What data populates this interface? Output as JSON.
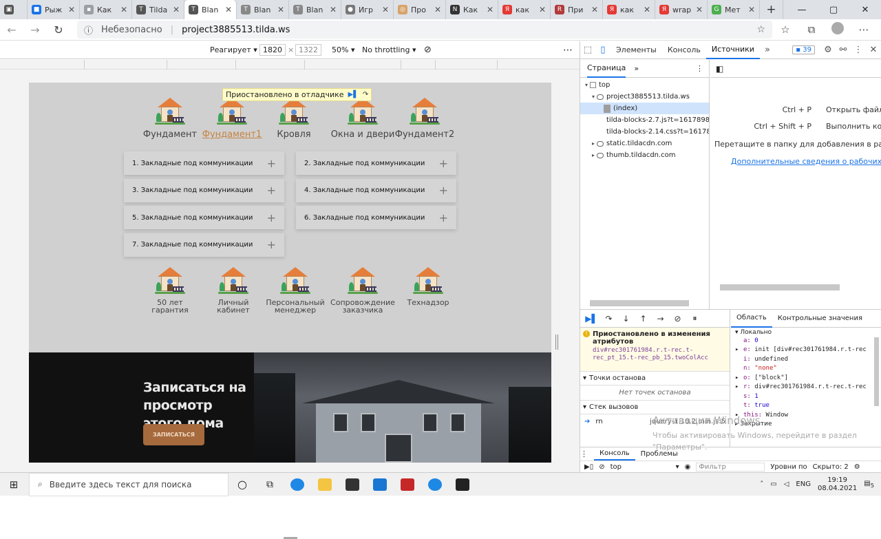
{
  "browser": {
    "tabs": [
      {
        "label": "Рыж",
        "color": "#1a73e8",
        "glyph": "■"
      },
      {
        "label": "Как",
        "color": "#9aa0a6",
        "glyph": "▪"
      },
      {
        "label": "Tilda",
        "color": "#555555",
        "glyph": "T"
      },
      {
        "label": "Blan",
        "color": "#555555",
        "glyph": "T"
      },
      {
        "label": "Blan",
        "color": "#888888",
        "glyph": "T"
      },
      {
        "label": "Blan",
        "color": "#888888",
        "glyph": "T"
      },
      {
        "label": "Игр",
        "color": "#777777",
        "glyph": "●"
      },
      {
        "label": "Про",
        "color": "#d7a36a",
        "glyph": "◎"
      },
      {
        "label": "Как",
        "color": "#333333",
        "glyph": "N"
      },
      {
        "label": "как",
        "color": "#e53935",
        "glyph": "Я"
      },
      {
        "label": "При",
        "color": "#b23b3b",
        "glyph": "R"
      },
      {
        "label": "как",
        "color": "#e53935",
        "glyph": "Я"
      },
      {
        "label": "wrap",
        "color": "#e53935",
        "glyph": "Я"
      },
      {
        "label": "Мет",
        "color": "#4caf50",
        "glyph": "G"
      }
    ],
    "active_tab": 3,
    "new_tab": "+",
    "url_security": "Небезопасно",
    "url": "project3885513.tilda.ws"
  },
  "devbar": {
    "responsive": "Реагирует",
    "width": "1820",
    "height": "1322",
    "zoom": "50%",
    "throttle": "No throttling"
  },
  "site": {
    "paused_label": "Приостановлено в отладчике",
    "categories": [
      {
        "label": "Фундамент",
        "active": false
      },
      {
        "label": "Фундамент1",
        "active": true
      },
      {
        "label": "Кровля",
        "active": false
      },
      {
        "label": "Окна и двери",
        "active": false
      },
      {
        "label": "Фундамент2",
        "active": false
      }
    ],
    "accordion": [
      "1. Закладные под коммуникации",
      "2. Закладные под коммуникации",
      "3. Закладные под коммуникации",
      "4. Закладные под коммуникации",
      "5. Закладные под коммуникации",
      "6. Закладные под коммуникации",
      "7. Закладные под коммуникации"
    ],
    "features": [
      {
        "l1": "50 лет",
        "l2": "гарантия"
      },
      {
        "l1": "Личный",
        "l2": "кабинет"
      },
      {
        "l1": "Персональный",
        "l2": "менеджер"
      },
      {
        "l1": "Сопровождение",
        "l2": "заказчика"
      },
      {
        "l1": "Технадзор",
        "l2": ""
      }
    ],
    "banner_title_1": "Записаться на просмотр",
    "banner_title_2": "этого дома",
    "banner_button": "ЗАПИСАТЬСЯ"
  },
  "devtools": {
    "tabs": [
      "Элементы",
      "Консоль",
      "Источники"
    ],
    "active_tab": "Источники",
    "issues_count": "39",
    "nav_tab": "Страница",
    "tree": {
      "top": "top",
      "project": "project3885513.tilda.ws",
      "index": "(index)",
      "js": "tilda-blocks-2.7.js?t=16178980",
      "css": "tilda-blocks-2.14.css?t=161789",
      "static": "static.tildacdn.com",
      "thumb": "thumb.tildacdn.com"
    },
    "shortcuts": [
      {
        "keys": "Ctrl + P",
        "action": "Открыть файл"
      },
      {
        "keys": "Ctrl + Shift + P",
        "action": "Выполнить ком"
      }
    ],
    "drop_hint": "Перетащите в папку для добавления в рабоч",
    "more_info": "Дополнительные сведения о рабочих об",
    "paused_title": "Приостановлено в изменения атрибутов",
    "paused_code": "div#rec301761984.r.t-rec.t-rec_pt_15.t-rec_pb_15.twoColAcc",
    "breakpoints_title": "Точки останова",
    "no_breakpoints": "Нет точек останова",
    "callstack_title": "Стек вызовов",
    "stack_fn": "rn",
    "stack_file": "jquery-1.10.2.min.js:5",
    "scope_tab": "Область",
    "watch_tab": "Контрольные значения",
    "local": "Локально",
    "scope": [
      {
        "k": "a:",
        "v": "0",
        "cls": "n",
        "exp": ""
      },
      {
        "k": "e:",
        "v": "init [div#rec301761984.r.t-rec",
        "cls": "",
        "exp": "▸"
      },
      {
        "k": "i:",
        "v": "undefined",
        "cls": "",
        "exp": ""
      },
      {
        "k": "n:",
        "v": "\"none\"",
        "cls": "s",
        "exp": ""
      },
      {
        "k": "o:",
        "v": "[\"block\"]",
        "cls": "",
        "exp": "▸"
      },
      {
        "k": "r:",
        "v": "div#rec301761984.r.t-rec.t-rec",
        "cls": "",
        "exp": "▸"
      },
      {
        "k": "s:",
        "v": "1",
        "cls": "n",
        "exp": ""
      },
      {
        "k": "t:",
        "v": "true",
        "cls": "n",
        "exp": ""
      },
      {
        "k": "this:",
        "v": "Window",
        "cls": "",
        "exp": "▸"
      }
    ],
    "closure": "Закрытие",
    "drawer_tabs": [
      "Консоль",
      "Проблемы"
    ],
    "context": "top",
    "filter_placeholder": "Фильтр",
    "levels": "Уровни по",
    "hidden": "Скрыто: 2"
  },
  "watermark": {
    "line1": "Активация Windows",
    "line2": "Чтобы активировать Windows, перейдите в раздел \"Параметры\"."
  },
  "taskbar": {
    "search_placeholder": "Введите здесь текст для поиска",
    "lang": "ENG",
    "time": "19:19",
    "date": "08.04.2021",
    "notif": "5"
  }
}
